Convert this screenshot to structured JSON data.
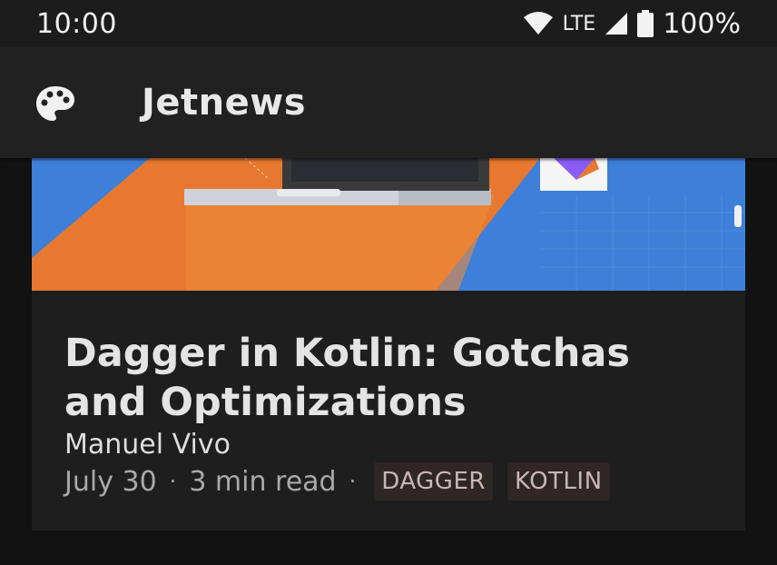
{
  "status_bar": {
    "time": "10:00",
    "network": "LTE",
    "battery": "100%",
    "icons": [
      "wifi-icon",
      "signal-icon",
      "battery-icon"
    ]
  },
  "app_bar": {
    "title": "Jetnews",
    "icon": "palette-icon"
  },
  "post": {
    "title": "Dagger in Kotlin: Gotchas and Optimizations",
    "author": "Manuel Vivo",
    "date": "July 30",
    "read_time": "3 min read",
    "separator": "·",
    "tags": [
      "DAGGER",
      "KOTLIN"
    ]
  },
  "colors": {
    "background": "#121212",
    "app_bar": "#212121",
    "card": "#1e1e1e",
    "tag_bg": "#2f2626",
    "hero_orange": "#e8782f",
    "hero_blue": "#3d7fd9"
  }
}
